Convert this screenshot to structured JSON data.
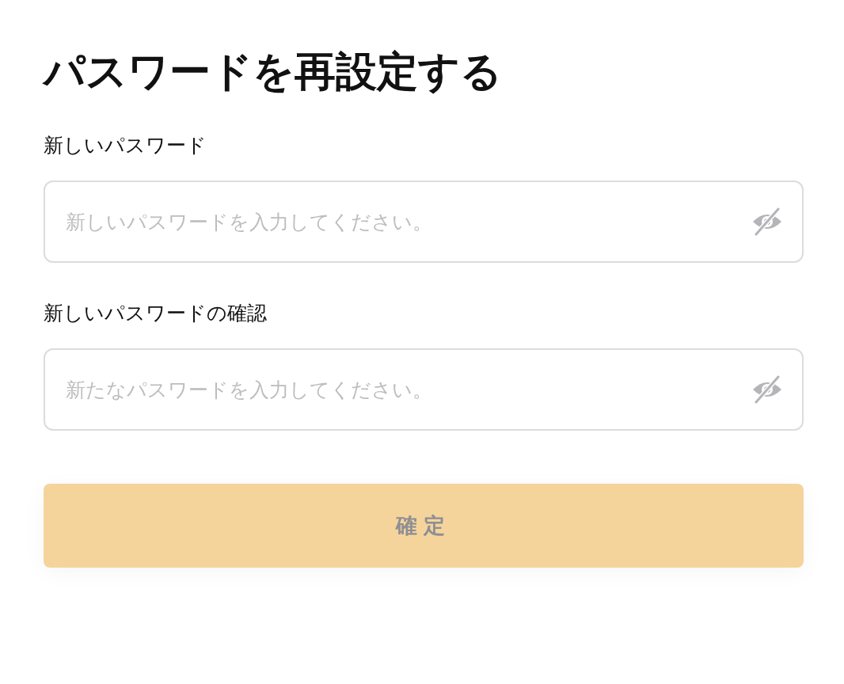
{
  "title": "パスワードを再設定する",
  "fields": [
    {
      "label": "新しいパスワード",
      "placeholder": "新しいパスワードを入力してください。",
      "password_visible": false
    },
    {
      "label": "新しいパスワードの確認",
      "placeholder": "新たなパスワードを入力してください。",
      "password_visible": false
    }
  ],
  "submit": {
    "label": "確定",
    "disabled": true
  }
}
